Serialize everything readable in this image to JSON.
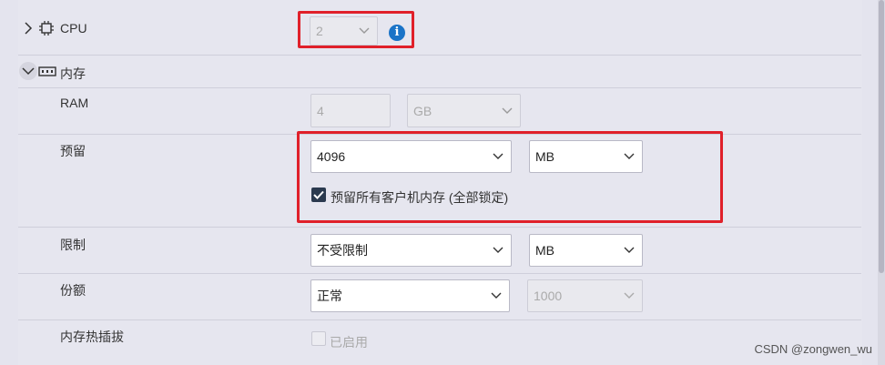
{
  "cpu": {
    "label": "CPU",
    "value": "2"
  },
  "memory": {
    "label": "内存",
    "ram": {
      "label": "RAM",
      "value": "4",
      "unit": "GB"
    },
    "reservation": {
      "label": "预留",
      "value": "4096",
      "unit": "MB",
      "reserve_all_label": "预留所有客户机内存 (全部锁定)",
      "reserve_all_checked": true
    },
    "limit": {
      "label": "限制",
      "value": "不受限制",
      "unit": "MB"
    },
    "shares": {
      "label": "份额",
      "value": "正常",
      "amount": "1000"
    },
    "hot_plug": {
      "label": "内存热插拔",
      "option_label": "已启用",
      "checked": false
    }
  },
  "watermark": "CSDN @zongwen_wu",
  "colors": {
    "info": "#1a73c7",
    "highlight_border": "#e0202a"
  }
}
